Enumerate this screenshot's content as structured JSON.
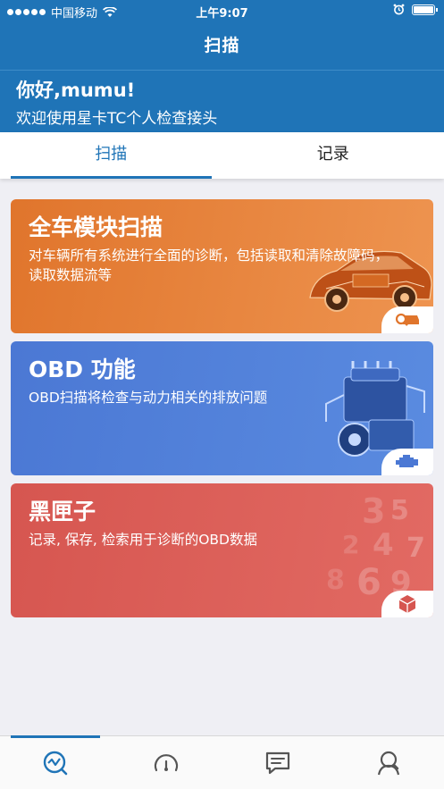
{
  "status_bar": {
    "carrier": "中国移动",
    "time": "上午9:07"
  },
  "nav": {
    "title": "扫描"
  },
  "greeting": {
    "hello": "你好,mumu!",
    "welcome": "欢迎使用星卡TC个人检查接头"
  },
  "tabs": [
    {
      "label": "扫描",
      "active": true
    },
    {
      "label": "记录",
      "active": false
    }
  ],
  "cards": [
    {
      "title": "全车模块扫描",
      "desc": "对车辆所有系统进行全面的诊断，包括读取和清除故障码，读取数据流等",
      "badge_icon": "car-search-icon",
      "color": "#e0752c"
    },
    {
      "title": "OBD 功能",
      "desc": "OBD扫描将检查与动力相关的排放问题",
      "badge_icon": "engine-icon",
      "color": "#4b78d4"
    },
    {
      "title": "黑匣子",
      "desc": "记录, 保存, 检索用于诊断的OBD数据",
      "badge_icon": "cube-icon",
      "color": "#d65650"
    }
  ],
  "bottom_tabs": [
    {
      "icon": "scan-chart-icon",
      "active": true
    },
    {
      "icon": "gauge-icon",
      "active": false
    },
    {
      "icon": "chat-icon",
      "active": false
    },
    {
      "icon": "user-search-icon",
      "active": false
    }
  ],
  "accent_color": "#1f74b7"
}
